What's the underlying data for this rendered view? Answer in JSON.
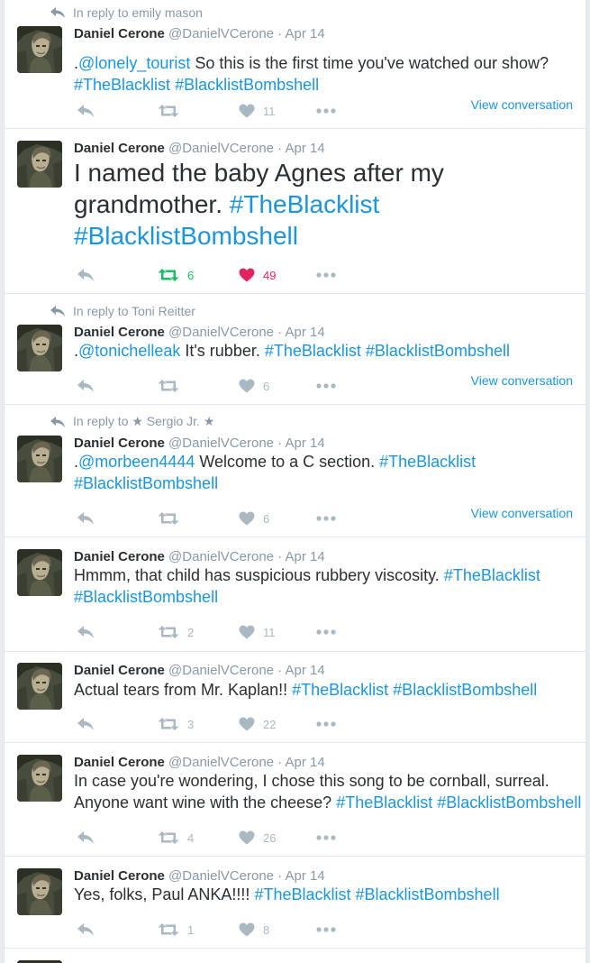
{
  "user": {
    "name": "Daniel Cerone",
    "handle": "@DanielVCerone"
  },
  "view_conversation_label": "View conversation",
  "tweets": [
    {
      "reply_to": "In reply to emily mason",
      "date": "Apr 14",
      "text": [
        {
          "t": ".",
          "l": false
        },
        {
          "t": "@lonely_tourist",
          "l": true
        },
        {
          "t": " So this is the first time you've watched our show? ",
          "l": false
        },
        {
          "t": "#TheBlacklist",
          "l": true
        },
        {
          "t": " ",
          "l": false
        },
        {
          "t": "#BlacklistBombshell",
          "l": true
        }
      ],
      "retweets": "",
      "likes": "11",
      "liked": false,
      "retweeted": false,
      "view_conversation": true,
      "big": false
    },
    {
      "reply_to": "",
      "date": "Apr 14",
      "text": [
        {
          "t": "I named the baby Agnes after my grandmother. ",
          "l": false
        },
        {
          "t": "#TheBlacklist",
          "l": true
        },
        {
          "t": " ",
          "l": false
        },
        {
          "t": "#BlacklistBombshell",
          "l": true
        }
      ],
      "retweets": "6",
      "likes": "49",
      "liked": true,
      "retweeted": true,
      "view_conversation": false,
      "big": true
    },
    {
      "reply_to": "In reply to Toni Reitter",
      "date": "Apr 14",
      "text": [
        {
          "t": ".",
          "l": false
        },
        {
          "t": "@tonichelleak",
          "l": true
        },
        {
          "t": " It's rubber. ",
          "l": false
        },
        {
          "t": "#TheBlacklist",
          "l": true
        },
        {
          "t": " ",
          "l": false
        },
        {
          "t": "#BlacklistBombshell",
          "l": true
        }
      ],
      "retweets": "",
      "likes": "6",
      "liked": false,
      "retweeted": false,
      "view_conversation": true,
      "big": false
    },
    {
      "reply_to": "In reply to ★ Sergio Jr. ★",
      "date": "Apr 14",
      "text": [
        {
          "t": ".",
          "l": false
        },
        {
          "t": "@morbeen4444",
          "l": true
        },
        {
          "t": " Welcome to a C section. ",
          "l": false
        },
        {
          "t": "#TheBlacklist",
          "l": true
        },
        {
          "t": " ",
          "l": false
        },
        {
          "t": "#BlacklistBombshell",
          "l": true
        }
      ],
      "retweets": "",
      "likes": "6",
      "liked": false,
      "retweeted": false,
      "view_conversation": true,
      "big": false
    },
    {
      "reply_to": "",
      "date": "Apr 14",
      "text": [
        {
          "t": "Hmmm, that child has suspicious rubbery viscosity. ",
          "l": false
        },
        {
          "t": "#TheBlacklist",
          "l": true
        },
        {
          "t": " ",
          "l": false
        },
        {
          "t": "#BlacklistBombshell",
          "l": true
        }
      ],
      "retweets": "2",
      "likes": "11",
      "liked": false,
      "retweeted": false,
      "view_conversation": false,
      "big": false
    },
    {
      "reply_to": "",
      "date": "Apr 14",
      "text": [
        {
          "t": "Actual tears from Mr. Kaplan!! ",
          "l": false
        },
        {
          "t": "#TheBlacklist",
          "l": true
        },
        {
          "t": " ",
          "l": false
        },
        {
          "t": "#BlacklistBombshell",
          "l": true
        }
      ],
      "retweets": "3",
      "likes": "22",
      "liked": false,
      "retweeted": false,
      "view_conversation": false,
      "big": false
    },
    {
      "reply_to": "",
      "date": "Apr 14",
      "text": [
        {
          "t": "In case you're wondering, I chose this song to be cornball, surreal. Anyone want wine with the cheese? ",
          "l": false
        },
        {
          "t": "#TheBlacklist",
          "l": true
        },
        {
          "t": " ",
          "l": false
        },
        {
          "t": "#BlacklistBombshell",
          "l": true
        }
      ],
      "retweets": "4",
      "likes": "26",
      "liked": false,
      "retweeted": false,
      "view_conversation": false,
      "big": false
    },
    {
      "reply_to": "",
      "date": "Apr 14",
      "text": [
        {
          "t": "Yes, folks, Paul ANKA!!!! ",
          "l": false
        },
        {
          "t": "#TheBlacklist",
          "l": true
        },
        {
          "t": " ",
          "l": false
        },
        {
          "t": "#BlacklistBombshell",
          "l": true
        }
      ],
      "retweets": "1",
      "likes": "8",
      "liked": false,
      "retweeted": false,
      "view_conversation": false,
      "big": false
    }
  ]
}
